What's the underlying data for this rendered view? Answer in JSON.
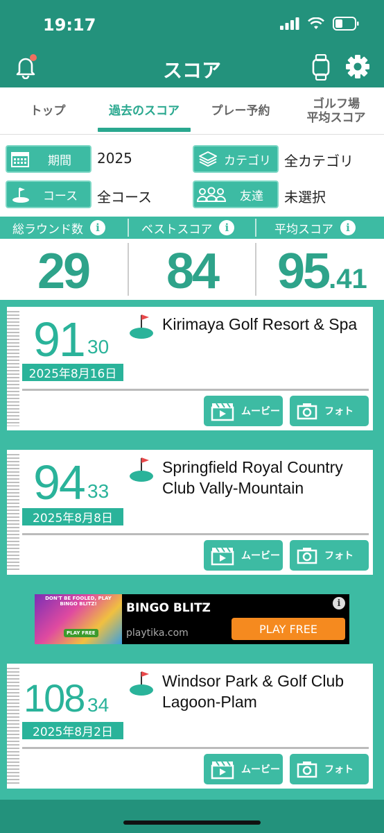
{
  "status": {
    "time": "19:17"
  },
  "header": {
    "title": "スコア",
    "bell_icon": "bell-icon",
    "watch_icon": "watch-icon",
    "settings_icon": "gear-icon"
  },
  "tabs": [
    {
      "label": "トップ",
      "active": false
    },
    {
      "label": "過去のスコア",
      "active": true
    },
    {
      "label": "プレー予約",
      "active": false
    },
    {
      "label": "ゴルフ場\n平均スコア",
      "active": false
    }
  ],
  "filters": {
    "period": {
      "label": "期間",
      "value": "2025"
    },
    "category": {
      "label": "カテゴリ",
      "value": "全カテゴリ"
    },
    "course": {
      "label": "コース",
      "value": "全コース"
    },
    "friends": {
      "label": "友達",
      "value": "未選択"
    }
  },
  "stats": {
    "rounds": {
      "label": "総ラウンド数",
      "value": "29"
    },
    "best": {
      "label": "ベストスコア",
      "value": "84"
    },
    "average": {
      "label": "平均スコア",
      "value_int": "95",
      "value_dec": ".41"
    }
  },
  "rounds": [
    {
      "score": "91",
      "putts": "30",
      "date": "2025年8月16日",
      "course": "Kirimaya Golf Resort & Spa",
      "movie": "ムービー",
      "photo": "フォト"
    },
    {
      "score": "94",
      "putts": "33",
      "date": "2025年8月8日",
      "course": "Springfield Royal Country Club Vally-Mountain",
      "movie": "ムービー",
      "photo": "フォト"
    },
    {
      "score": "108",
      "putts": "34",
      "date": "2025年8月2日",
      "course": "Windsor Park & Golf Club Lagoon-Plam",
      "movie": "ムービー",
      "photo": "フォト"
    }
  ],
  "ad": {
    "image_text": "DON'T BE FOOLED, PLAY BINGO BLITZ!",
    "image_button": "PLAY FREE",
    "title": "BINGO BLITZ",
    "url": "playtika.com",
    "cta": "PLAY FREE",
    "info": "i"
  },
  "colors": {
    "primary": "#3dbba3",
    "dark": "#23927c",
    "score": "#2ab39a",
    "badge_dot": "#f07060",
    "ad_cta": "#f58a1f"
  }
}
